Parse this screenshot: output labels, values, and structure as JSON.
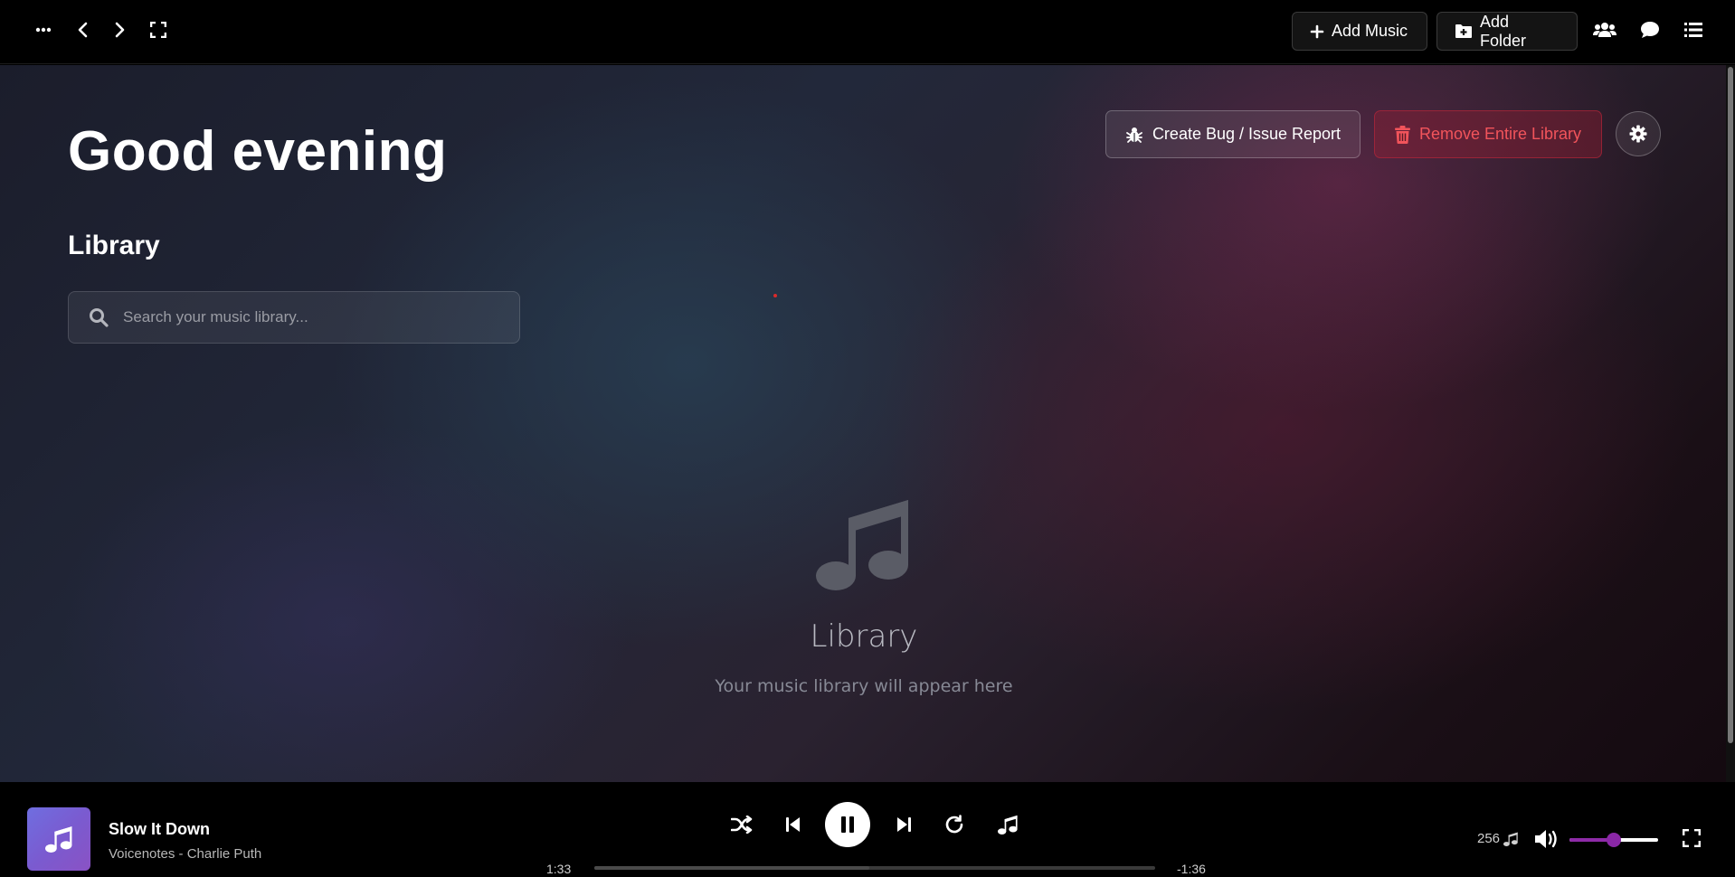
{
  "topbar": {
    "icons": [
      "more-icon",
      "back-icon",
      "forward-icon",
      "fullscreen-icon"
    ],
    "add_music_label": "Add Music",
    "add_folder_label": "Add Folder",
    "right_icons": [
      "users-icon",
      "chat-icon",
      "list-icon"
    ]
  },
  "main": {
    "greeting": "Good evening",
    "section_title": "Library",
    "search_placeholder": "Search your music library...",
    "bug_report_label": "Create Bug / Issue Report",
    "remove_library_label": "Remove Entire Library",
    "empty_state": {
      "title": "Library",
      "subtitle": "Your music library will appear here"
    }
  },
  "player": {
    "track_title": "Slow It Down",
    "track_subtitle": "Voicenotes - Charlie Puth",
    "time_current": "1:33",
    "time_remaining": "-1:36",
    "progress": 0.49,
    "bitrate": "256",
    "volume": 0.5
  },
  "colors": {
    "accent": "#8a27a6",
    "danger": "#f2545b",
    "art_gradient_start": "#6f6ee0",
    "art_gradient_end": "#8a52c4"
  }
}
